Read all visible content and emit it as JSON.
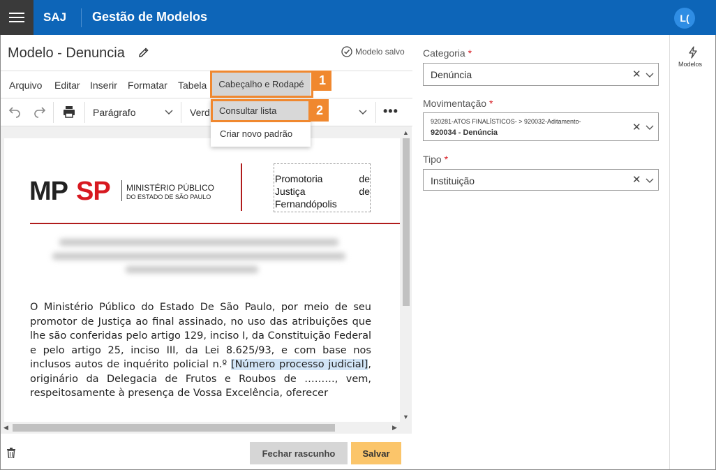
{
  "header": {
    "brand": "SAJ",
    "app_title": "Gestão de Modelos",
    "avatar_initials": "L(",
    "brand_color": "#0d65b8"
  },
  "document": {
    "title": "Modelo - Denuncia",
    "saved_status": "Modelo salvo"
  },
  "menubar": {
    "items": [
      "Arquivo",
      "Editar",
      "Inserir",
      "Formatar",
      "Tabela"
    ],
    "active": "Cabeçalho e Rodapé"
  },
  "toolbar": {
    "style": "Parágrafo",
    "font": "Verd"
  },
  "dropdown": {
    "items": [
      "Consultar lista",
      "Criar novo padrão"
    ]
  },
  "callouts": {
    "one": "1",
    "two": "2",
    "color": "#f0882f"
  },
  "letterhead": {
    "logo_mp": "MP",
    "logo_sp": "SP",
    "logo_line1": "MINISTÉRIO PÚBLICO",
    "logo_line2": "DO ESTADO DE SÃO PAULO",
    "box_line1a": "Promotoria",
    "box_line1b": "de",
    "box_line2a": "Justiça",
    "box_line2b": "de",
    "box_line3": "Fernandópolis"
  },
  "body": {
    "text_before": "O Ministério Público do Estado De São Paulo, por meio de seu promotor de Justiça ao final assinado, no uso das atribuições que lhe são conferidas pelo artigo 129, inciso I, da Constituição Federal e pelo artigo 25, inciso III, da Lei 8.625/93, e com base nos inclusos autos de inquérito policial n.º ",
    "placeholder": "[Número processo judicial]",
    "text_after": ", originário da Delegacia de Frutos e Roubos de ………, vem, respeitosamente à presença de Vossa Excelência, oferecer"
  },
  "actions": {
    "close_draft": "Fechar rascunho",
    "save": "Salvar"
  },
  "form": {
    "categoria_label": "Categoria",
    "categoria_value": "Denúncia",
    "movimentacao_label": "Movimentação",
    "movimentacao_line1": "920281-ATOS FINALÍSTICOS- > 920032-Aditamento-",
    "movimentacao_line2": "920034 - Denúncia",
    "tipo_label": "Tipo",
    "tipo_value": "Instituição",
    "required_mark": "*"
  },
  "sidebar": {
    "modelos_label": "Modelos"
  }
}
